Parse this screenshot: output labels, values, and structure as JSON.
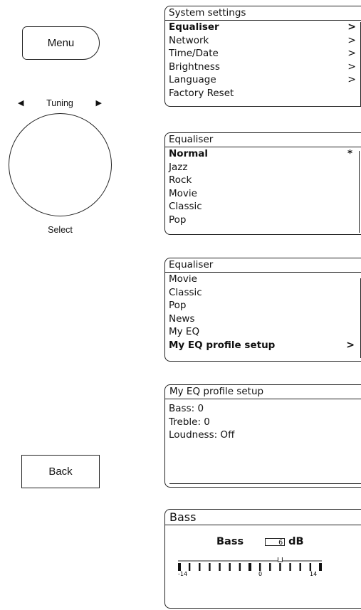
{
  "controls": {
    "menu_label": "Menu",
    "tuning_label": "Tuning",
    "tuning_left": "◀",
    "tuning_right": "▶",
    "select_label": "Select",
    "back_label": "Back"
  },
  "screen1": {
    "title": "System settings",
    "items": [
      {
        "label": "Equaliser",
        "arrow": ">"
      },
      {
        "label": "Network",
        "arrow": ">"
      },
      {
        "label": "Time/Date",
        "arrow": ">"
      },
      {
        "label": "Brightness",
        "arrow": ">"
      },
      {
        "label": "Language",
        "arrow": ">"
      },
      {
        "label": "Factory Reset",
        "arrow": ""
      }
    ]
  },
  "screen2": {
    "title": "Equaliser",
    "items": [
      "Normal",
      "Jazz",
      "Rock",
      "Movie",
      "Classic",
      "Pop"
    ],
    "marker": "*"
  },
  "screen3": {
    "title": "Equaliser",
    "items": [
      "Movie",
      "Classic",
      "Pop",
      "News",
      "My EQ",
      "My EQ profile setup"
    ],
    "arrow": ">"
  },
  "screen4": {
    "title": "My EQ profile setup",
    "items": [
      "Bass: 0",
      "Treble: 0",
      "Loudness: Off"
    ]
  },
  "screen5": {
    "title": "Bass",
    "label": "Bass",
    "value": "6",
    "unit": "dB",
    "scale_min": "-14",
    "scale_mid": "0",
    "scale_max": "14",
    "level": 6
  }
}
